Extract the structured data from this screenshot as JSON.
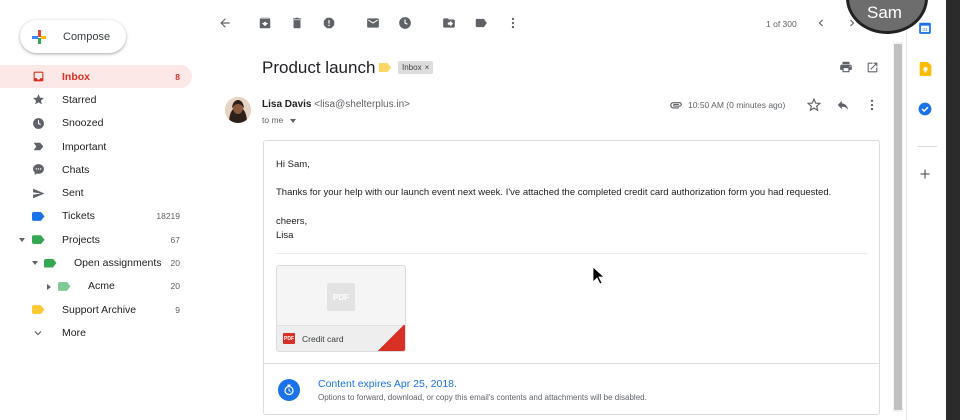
{
  "compose": {
    "label": "Compose"
  },
  "nav": [
    {
      "label": "Inbox",
      "count": "8"
    },
    {
      "label": "Starred",
      "count": ""
    },
    {
      "label": "Snoozed",
      "count": ""
    },
    {
      "label": "Important",
      "count": ""
    },
    {
      "label": "Chats",
      "count": ""
    },
    {
      "label": "Sent",
      "count": ""
    },
    {
      "label": "Tickets",
      "count": "18219"
    },
    {
      "label": "Projects",
      "count": "67"
    },
    {
      "label": "Open assignments",
      "count": "20"
    },
    {
      "label": "Acme",
      "count": "20"
    },
    {
      "label": "Support Archive",
      "count": "9"
    },
    {
      "label": "More",
      "count": ""
    }
  ],
  "label_colors": {
    "tickets": "#1a73e8",
    "projects": "#34a853",
    "open_assignments": "#34a853",
    "acme": "#81c995",
    "support_archive": "#fcc934"
  },
  "toolbar": {
    "pager": "1 of 300"
  },
  "email": {
    "subject": "Product launch",
    "label_chip": "Inbox",
    "chip_close": "×",
    "sender_name": "Lisa Davis",
    "sender_email": "<lisa@shelterplus.in>",
    "to": "to me",
    "time": "10:50 AM (0 minutes ago)",
    "body": {
      "greeting": "Hi Sam,",
      "para": "Thanks for your help with our launch event next week. I've attached the completed credit card authorization form you had requested.",
      "signoff": "cheers,",
      "name": "Lisa"
    },
    "attachment": {
      "thumb_label": "PDF",
      "type_label": "PDF",
      "name": "Credit card"
    },
    "expiry": {
      "title": "Content expires Apr 25, 2018.",
      "subtitle": "Options to forward, download, or copy this email's contents and attachments will be disabled."
    }
  },
  "camera": {
    "name": "Sam"
  },
  "accent": "#d93025"
}
